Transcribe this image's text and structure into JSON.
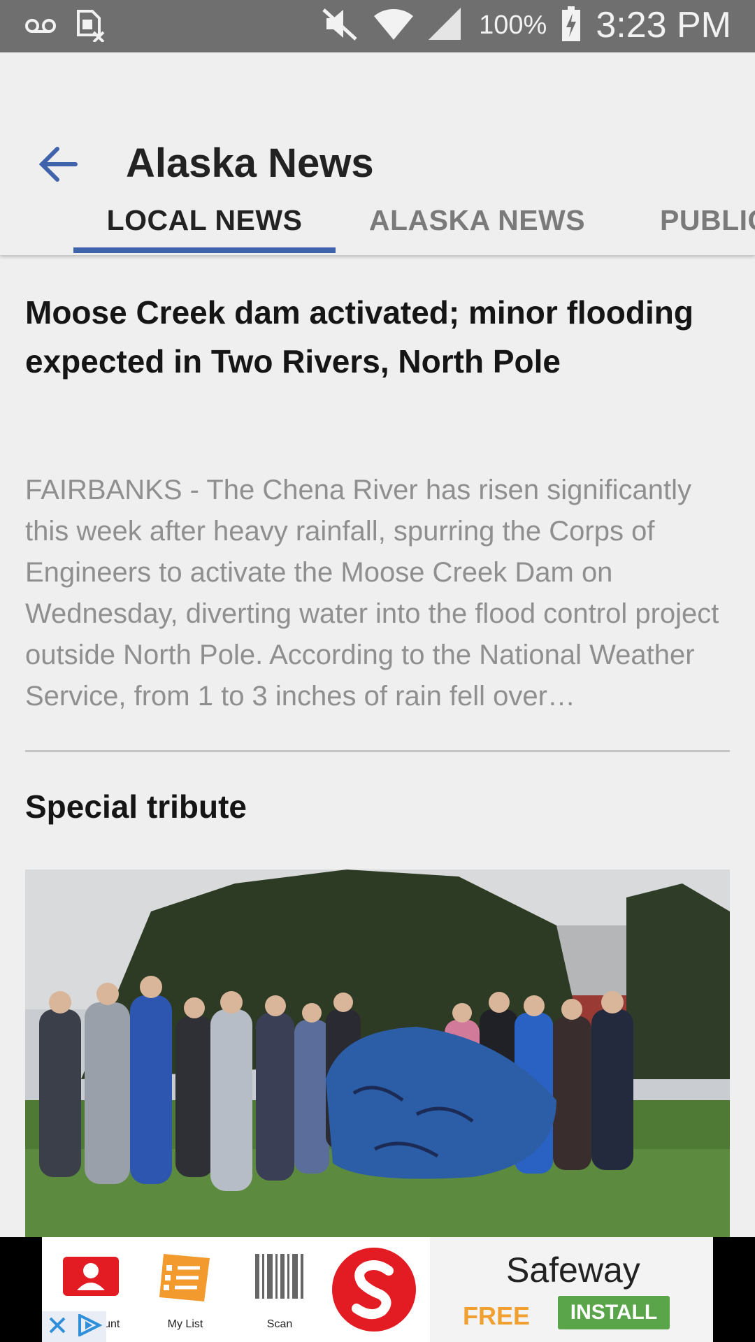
{
  "status_bar": {
    "battery": "100%",
    "time": "3:23 PM",
    "icons": [
      "voicemail-icon",
      "sim-error-icon",
      "mute-icon",
      "wifi-icon",
      "signal-icon",
      "battery-charging-icon"
    ]
  },
  "app_bar": {
    "title": "Alaska News",
    "back_icon": "arrow-back-icon",
    "accent_color": "#3f63aa"
  },
  "tabs": [
    {
      "label": "LOCAL NEWS",
      "active": true
    },
    {
      "label": "ALASKA NEWS",
      "active": false
    },
    {
      "label": "PUBLIC",
      "active": false
    }
  ],
  "articles": [
    {
      "headline": "Moose Creek dam activated; minor flooding expected in Two Rivers, North Pole",
      "summary": "FAIRBANKS - The Chena River has risen significantly this week after heavy rainfall, spurring the Corps of Engineers to activate the Moose Creek Dam on Wednesday, diverting water into the flood control project outside North Pole. According to the National Weather Service, from 1 to 3 inches of rain fell over…"
    },
    {
      "headline": "Special tribute",
      "image": "photo of students gathered around a blue-painted rock"
    }
  ],
  "ad": {
    "app_icons": [
      {
        "label": "My Account",
        "icon": "account-icon"
      },
      {
        "label": "My List",
        "icon": "list-icon"
      },
      {
        "label": "Scan",
        "icon": "barcode-icon"
      }
    ],
    "brand": "Safeway",
    "price": "FREE",
    "cta": "INSTALL",
    "brand_color": "#e31b23"
  }
}
